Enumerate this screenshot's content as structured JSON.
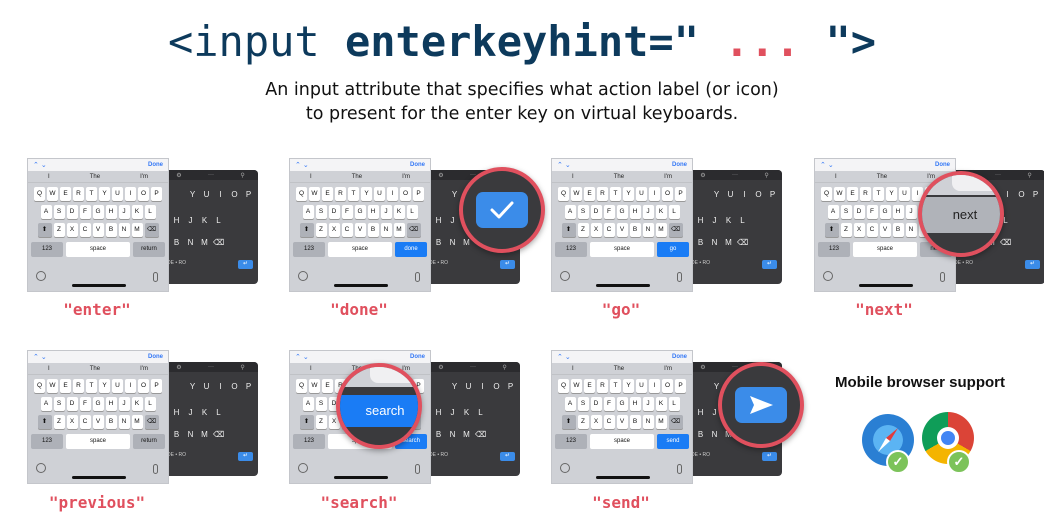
{
  "header": {
    "title_prefix": "<input ",
    "title_attr": "enterkeyhint=\"",
    "title_dots": " ... ",
    "title_suffix": "\">",
    "subtitle_line1": "An input attribute that specifies what action label (or icon)",
    "subtitle_line2": "to present for the enter key on virtual keyboards."
  },
  "keyboard": {
    "toolbar_done": "Done",
    "suggestions": [
      "I",
      "The",
      "I'm"
    ],
    "row1": [
      "Q",
      "W",
      "E",
      "R",
      "T",
      "Y",
      "U",
      "I",
      "O",
      "P"
    ],
    "row2": [
      "A",
      "S",
      "D",
      "F",
      "G",
      "H",
      "J",
      "K",
      "L"
    ],
    "row3": [
      "Z",
      "X",
      "C",
      "V",
      "B",
      "N",
      "M"
    ],
    "key_123": "123",
    "key_space": "space"
  },
  "variants": [
    {
      "label": "\"enter\"",
      "key": "return"
    },
    {
      "label": "\"done\"",
      "key": "done"
    },
    {
      "label": "\"go\"",
      "key": "go"
    },
    {
      "label": "\"next\"",
      "key": "next",
      "zoom_text": "next"
    },
    {
      "label": "\"previous\"",
      "key": "return"
    },
    {
      "label": "\"search\"",
      "key": "search",
      "zoom_text": "search"
    },
    {
      "label": "\"send\"",
      "key": "send"
    }
  ],
  "support": {
    "title": "Mobile browser support",
    "browsers": [
      "safari-icon",
      "chrome-icon"
    ]
  },
  "colors": {
    "accent": "#e0505e",
    "navy": "#0d3a5c",
    "key_blue": "#1a7cf5",
    "check_green": "#7cc35a"
  }
}
